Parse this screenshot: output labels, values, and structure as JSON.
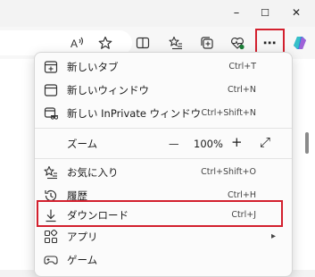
{
  "window": {
    "minimize_glyph": "–",
    "maximize_glyph": "☐",
    "close_glyph": "✕"
  },
  "toolbar": {
    "more_glyph": "⋯"
  },
  "menu": {
    "items": [
      {
        "label": "新しいタブ",
        "shortcut": "Ctrl+T",
        "icon": "new-tab-icon"
      },
      {
        "label": "新しいウィンドウ",
        "shortcut": "Ctrl+N",
        "icon": "new-window-icon"
      },
      {
        "label": "新しい InPrivate ウィンドウ",
        "shortcut": "Ctrl+Shift+N",
        "icon": "inprivate-icon"
      },
      {
        "label": "お気に入り",
        "shortcut": "Ctrl+Shift+O",
        "icon": "favorites-icon"
      },
      {
        "label": "履歴",
        "shortcut": "Ctrl+H",
        "icon": "history-icon"
      },
      {
        "label": "ダウンロード",
        "shortcut": "Ctrl+J",
        "icon": "download-icon"
      },
      {
        "label": "アプリ",
        "shortcut": "",
        "icon": "apps-icon"
      },
      {
        "label": "ゲーム",
        "shortcut": "",
        "icon": "games-icon"
      }
    ],
    "zoom": {
      "label": "ズーム",
      "minus": "—",
      "value": "100%",
      "plus": "+",
      "fullscreen_glyph": "⤢"
    },
    "apps_arrow": "▸"
  },
  "highlight_color": "#d3202e"
}
